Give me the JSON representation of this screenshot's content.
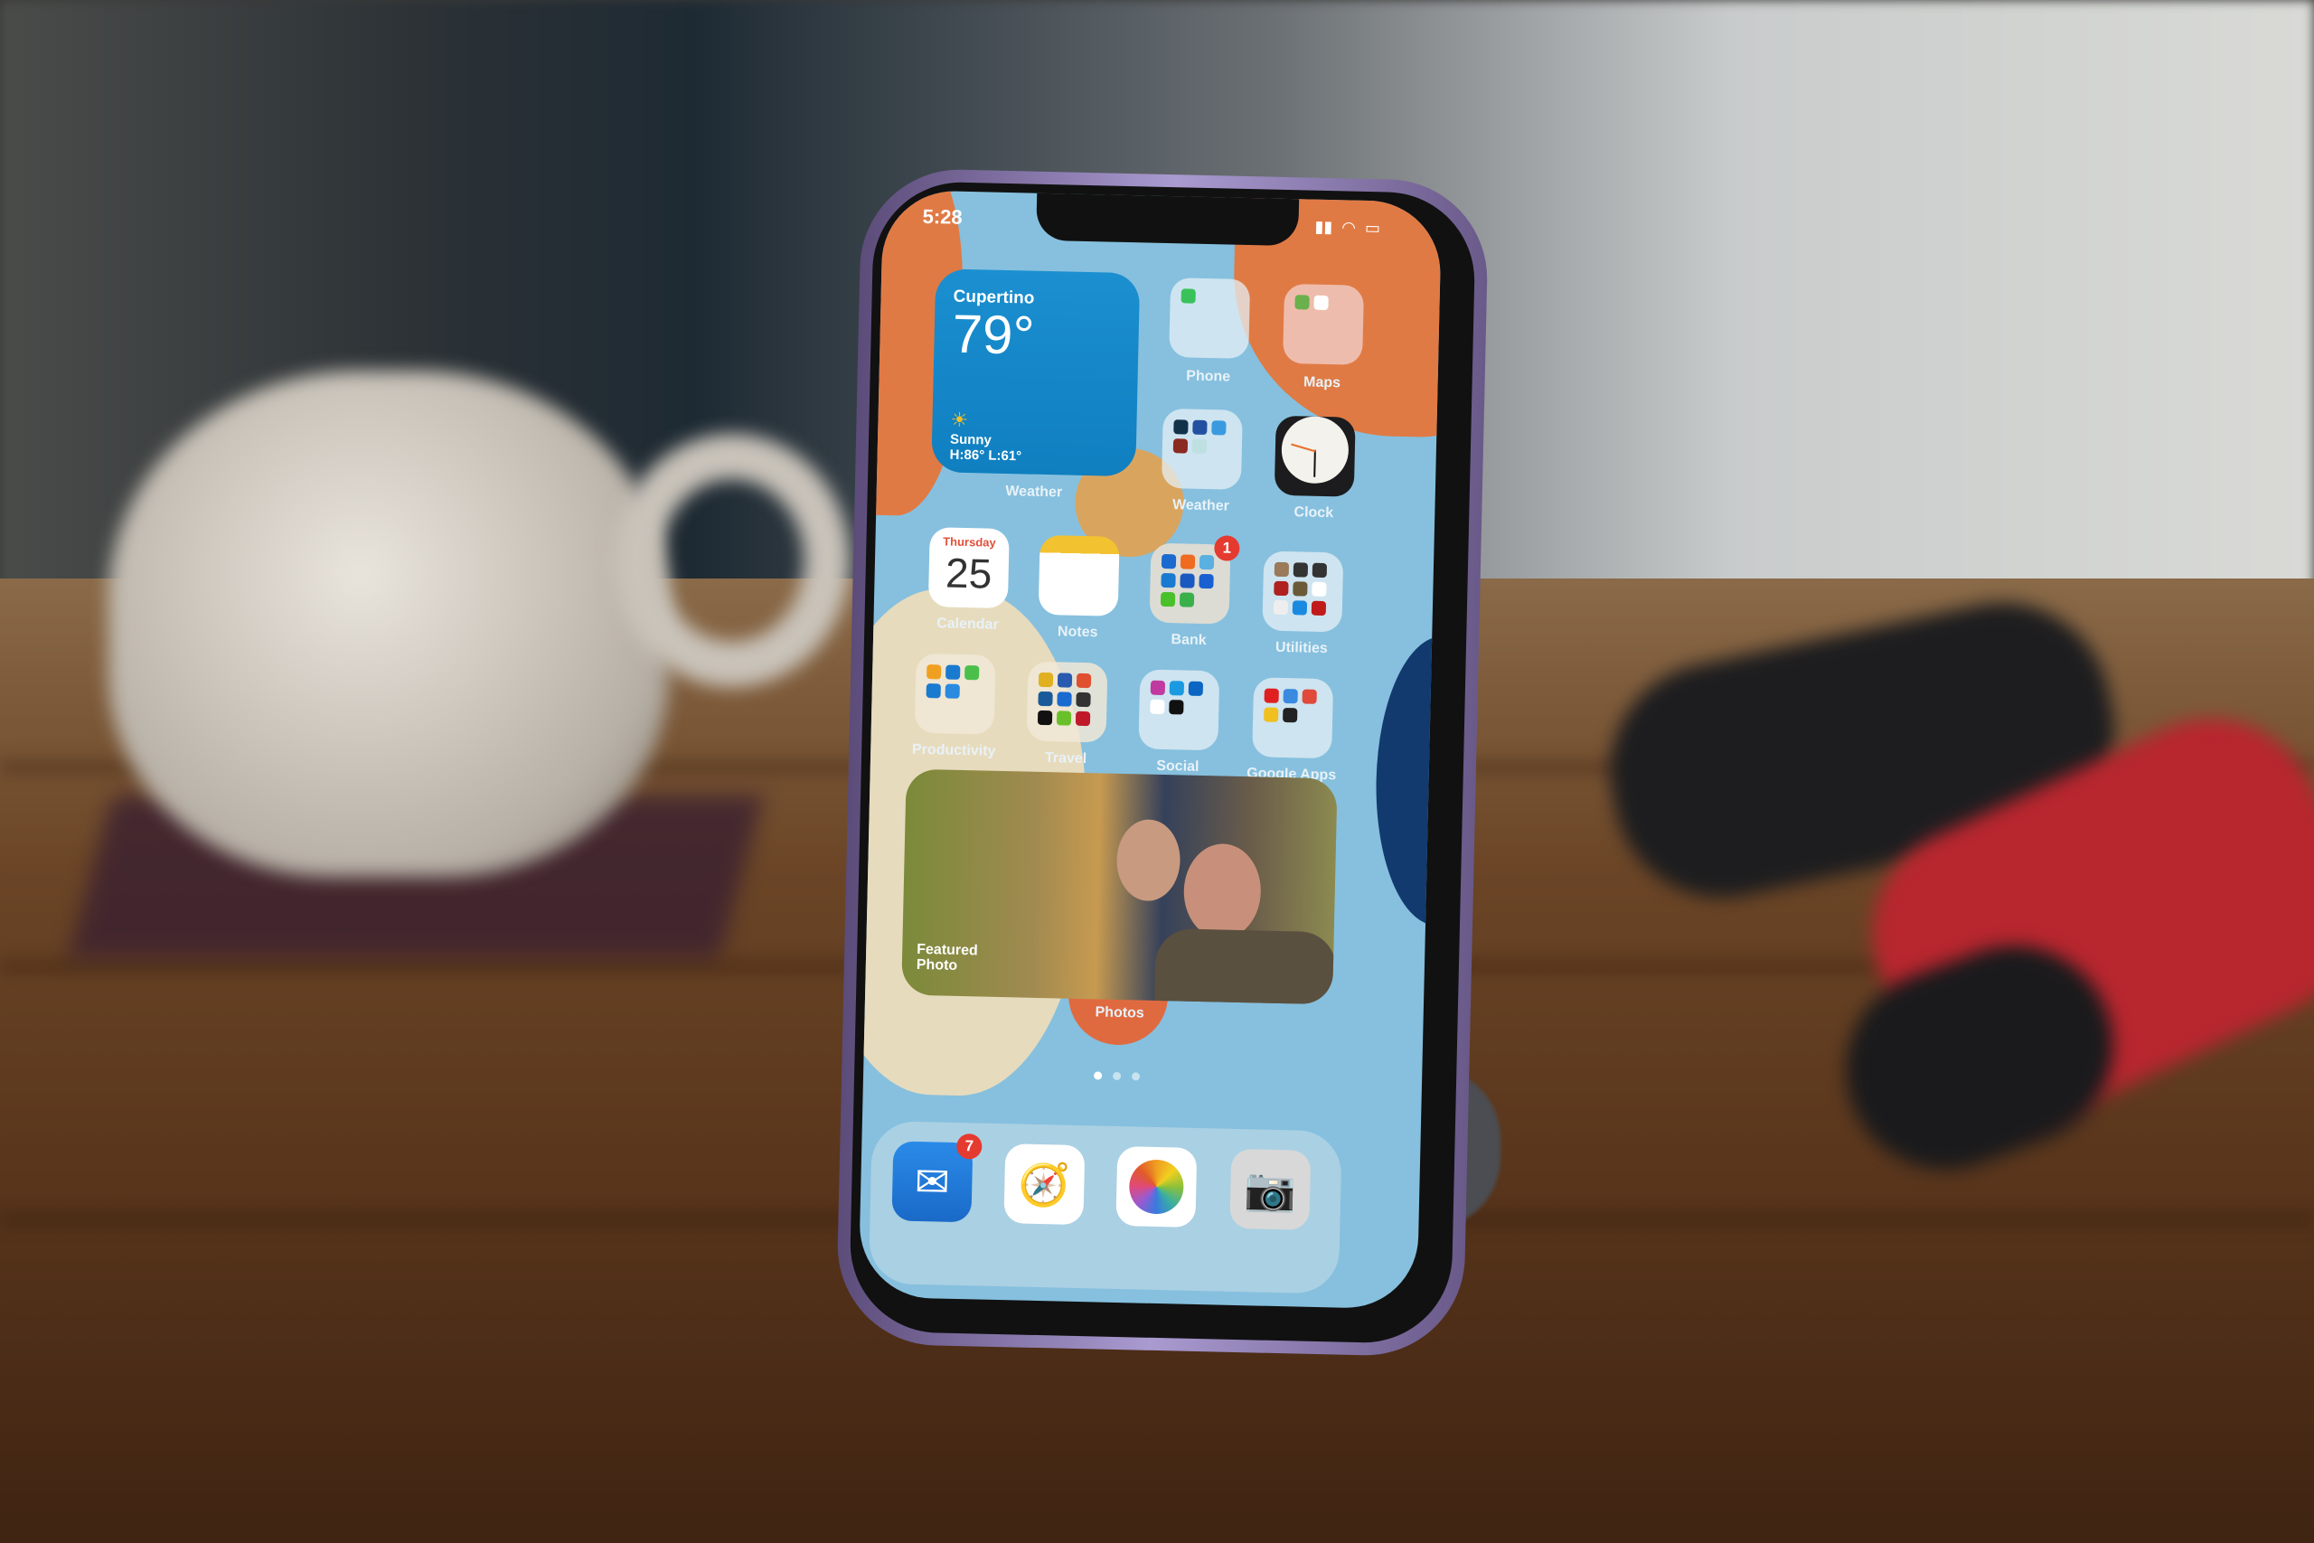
{
  "status_bar": {
    "time": "5:28",
    "icons": [
      "cellular-signal-icon",
      "wifi-icon",
      "battery-icon"
    ]
  },
  "weather_widget": {
    "city": "Cupertino",
    "temperature": "79°",
    "condition": "Sunny",
    "high_low": "H:86° L:61°",
    "label": "Weather",
    "icon": "sun-icon"
  },
  "calendar": {
    "day": "Thursday",
    "date": "25",
    "label": "Calendar"
  },
  "apps": [
    {
      "label": "Phone",
      "kind": "folder"
    },
    {
      "label": "Maps",
      "kind": "folder"
    },
    {
      "label": "Weather",
      "kind": "folder"
    },
    {
      "label": "Clock",
      "kind": "app"
    },
    {
      "label": "Notes",
      "kind": "app"
    },
    {
      "label": "Bank",
      "kind": "folder",
      "badge": "1"
    },
    {
      "label": "Utilities",
      "kind": "folder"
    },
    {
      "label": "Productivity",
      "kind": "folder"
    },
    {
      "label": "Travel",
      "kind": "folder"
    },
    {
      "label": "Social",
      "kind": "folder"
    },
    {
      "label": "Google Apps",
      "kind": "folder"
    }
  ],
  "photos_widget": {
    "caption": "Featured Photo",
    "label": "Photos"
  },
  "page_indicator": {
    "pages": 3,
    "current": 1
  },
  "dock": [
    {
      "app": "Mail",
      "icon": "mail-icon",
      "badge": "7"
    },
    {
      "app": "Safari",
      "icon": "compass-icon"
    },
    {
      "app": "Photos",
      "icon": "photos-flower-icon"
    },
    {
      "app": "Camera",
      "icon": "camera-icon"
    }
  ],
  "colors": {
    "wallpaper_blue": "#86c0de",
    "wallpaper_orange": "#e07a44",
    "badge_red": "#e53a2f",
    "phone_body": "#a99ad0"
  }
}
